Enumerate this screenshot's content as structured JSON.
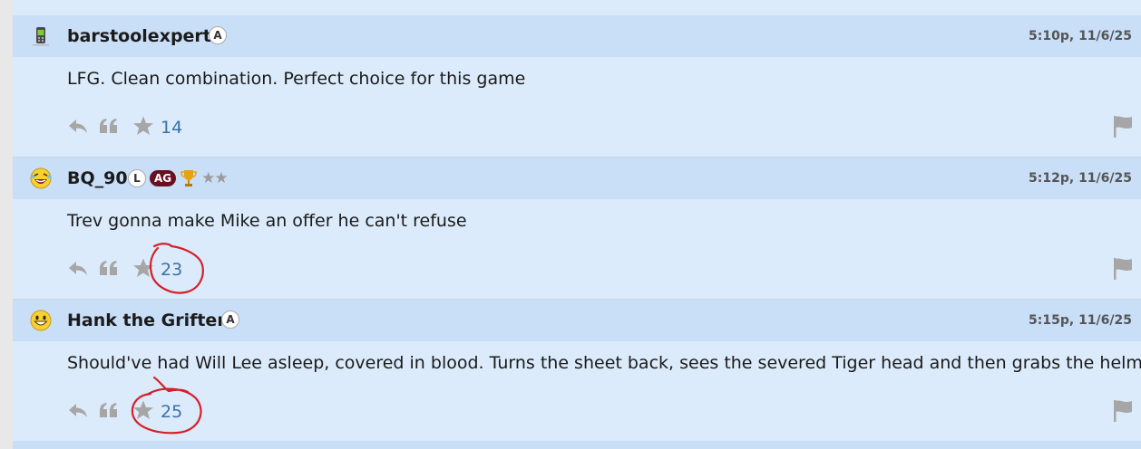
{
  "posts": [
    {
      "username": "barstoolexpert",
      "avatar": "phone-icon",
      "badges": [
        "A"
      ],
      "timestamp": "5:10p, 11/6/25",
      "body": "LFG. Clean combination. Perfect choice for this game",
      "likes": "14"
    },
    {
      "username": "BQ_90",
      "avatar": "laughing-face-icon",
      "badges": [
        "L",
        "AG"
      ],
      "rank_stars": "★★",
      "timestamp": "5:12p, 11/6/25",
      "body": "Trev gonna make Mike an offer he can't refuse",
      "likes": "23"
    },
    {
      "username": "Hank the Grifter",
      "avatar": "smiley-face-icon",
      "badges": [
        "A"
      ],
      "timestamp": "5:15p, 11/6/25",
      "body": "Should've had Will Lee asleep, covered in blood. Turns the sheet back, sees the severed Tiger head and then grabs the helmet.",
      "likes": "25"
    }
  ],
  "colors": {
    "header_bg": "#c9def7",
    "post_bg": "#dcebfb",
    "count_color": "#3b70a6",
    "annotation_red": "#d4202a"
  }
}
